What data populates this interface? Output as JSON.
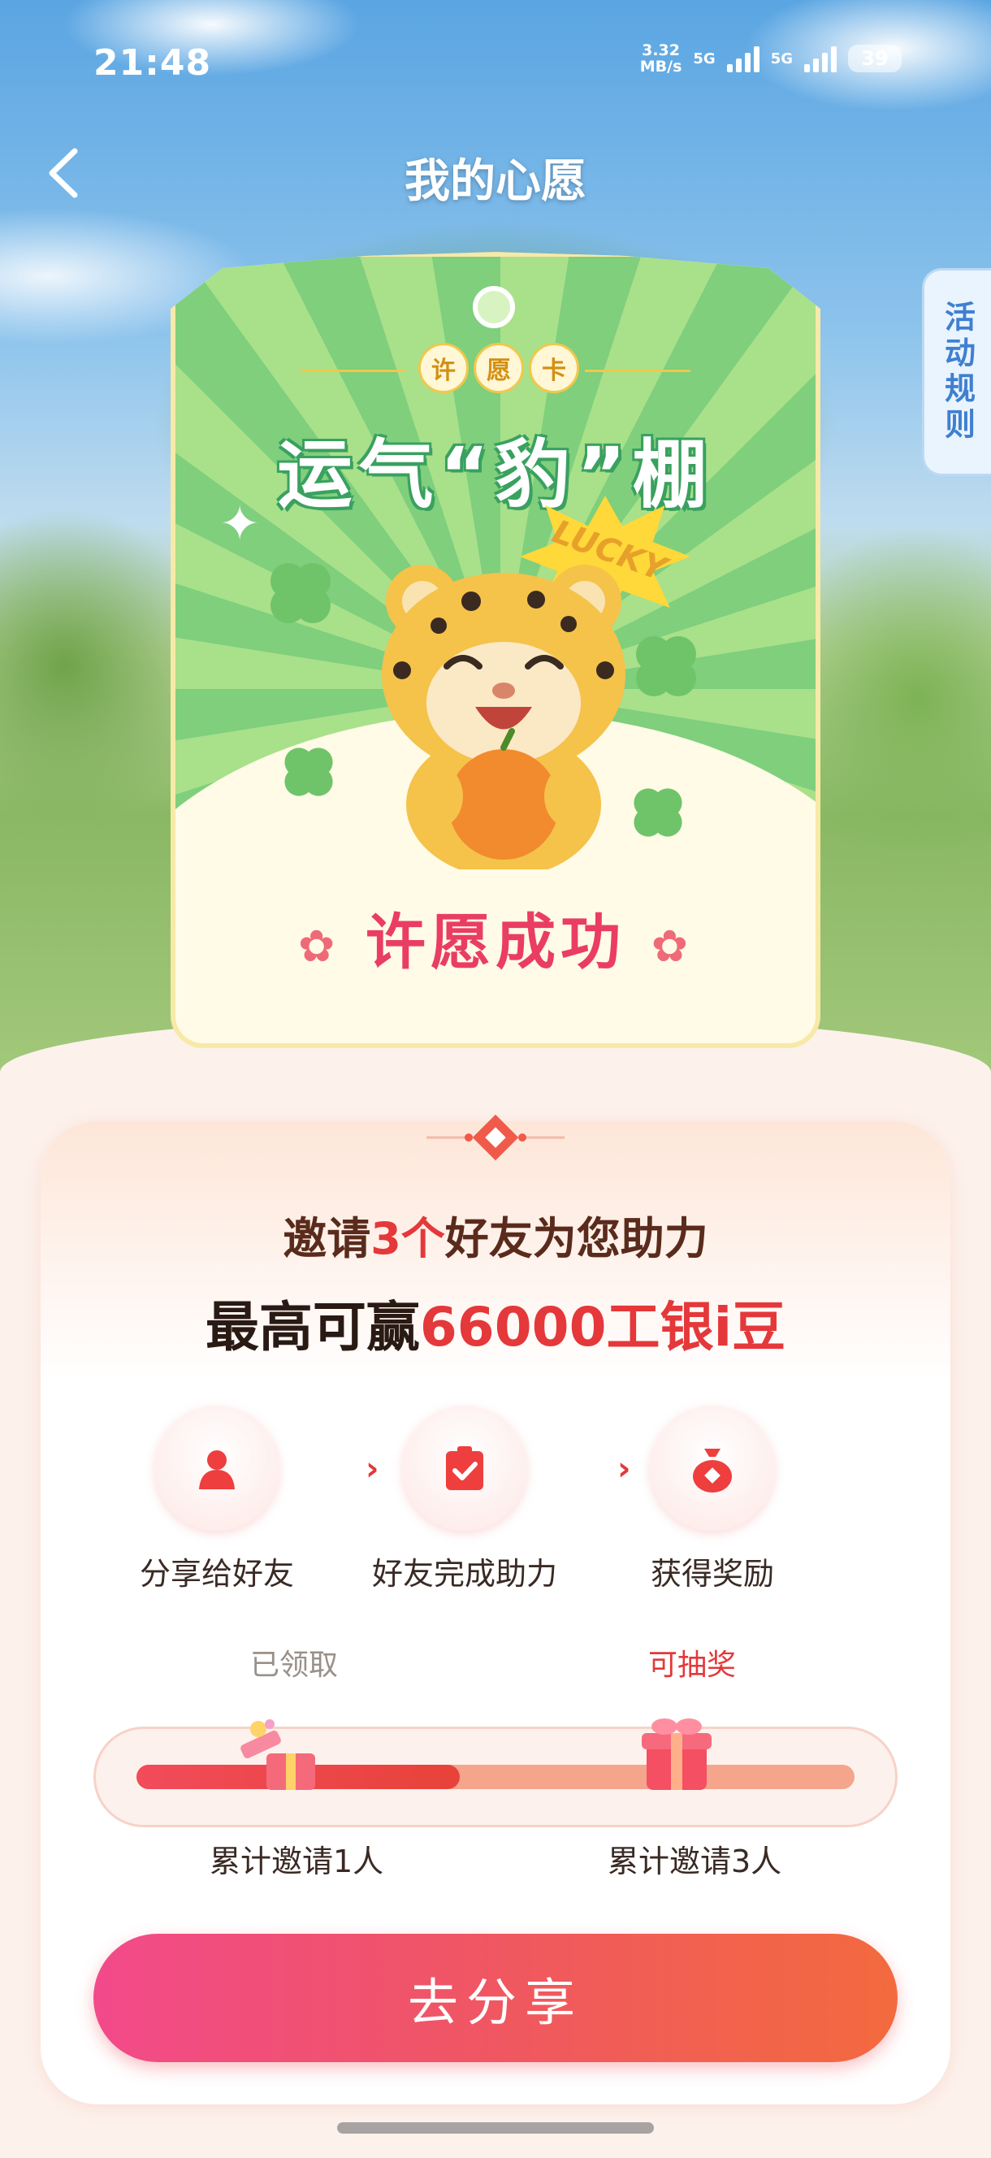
{
  "status_bar": {
    "time": "21:48",
    "speed_value": "3.32",
    "speed_unit": "MB/s",
    "net1": "5G",
    "net2": "5G",
    "battery": "39"
  },
  "header": {
    "title": "我的心愿"
  },
  "rules_tab": {
    "label": "活动规则"
  },
  "wish_card": {
    "tag_chars": [
      "许",
      "愿",
      "卡"
    ],
    "slogan": "运气“豹”棚",
    "badge": "LUCKY",
    "status": "许愿成功"
  },
  "invite_panel": {
    "invite_prefix": "邀请",
    "invite_count": "3个",
    "invite_suffix": "好友为您助力",
    "prize_prefix": "最高可赢",
    "prize_value": "66000工银i豆",
    "steps": [
      {
        "label": "分享给好友",
        "icon": "user-icon"
      },
      {
        "label": "好友完成助力",
        "icon": "clipboard-check-icon"
      },
      {
        "label": "获得奖励",
        "icon": "money-bag-icon"
      }
    ],
    "progress": {
      "label_claimed": "已领取",
      "label_drawable": "可抽奖",
      "count_1": "累计邀请1人",
      "count_3": "累计邀请3人",
      "fill_fraction": 0.45
    },
    "share_button": "去分享"
  },
  "colors": {
    "accent": "#e4383a",
    "share_start": "#f24a8a",
    "share_end": "#f36a3e",
    "rules_text": "#3f7fd1"
  }
}
